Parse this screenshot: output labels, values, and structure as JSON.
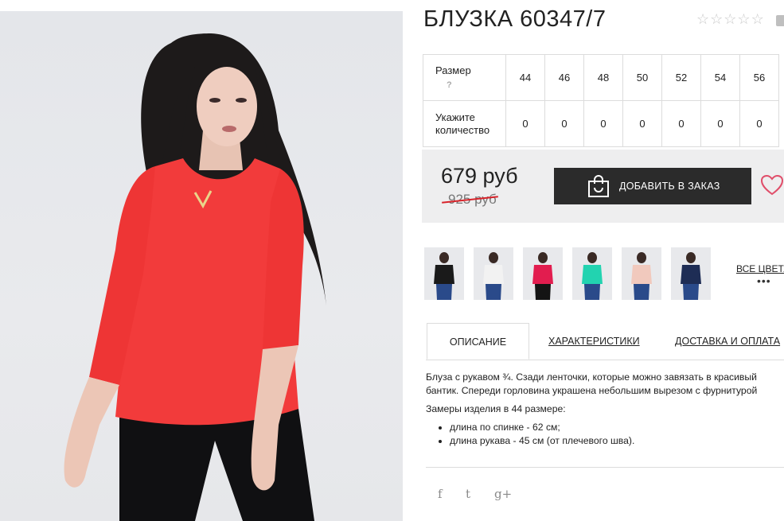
{
  "product": {
    "title": "БЛУЗКА 60347/7",
    "rating_icon": "star-outline-icon",
    "rating_max": 5,
    "rating_value": 0
  },
  "sizes": {
    "label": "Размер",
    "help": "?",
    "qty_label_line1": "Укажите",
    "qty_label_line2": "количество",
    "values": [
      "44",
      "46",
      "48",
      "50",
      "52",
      "54",
      "56"
    ],
    "quantities": [
      "0",
      "0",
      "0",
      "0",
      "0",
      "0",
      "0"
    ]
  },
  "price": {
    "current": "679 руб",
    "old": "925 руб",
    "add_button": "ДОБАВИТЬ В ЗАКАЗ"
  },
  "colors": {
    "all_colors_label": "ВСЕ ЦВЕТА",
    "more": "•••",
    "swatches": [
      "#1a1a1a",
      "#f2f2f2",
      "#e21d4f",
      "#22d3b0",
      "#f1c9bd",
      "#1e2d55"
    ]
  },
  "tabs": [
    {
      "label": "ОПИСАНИЕ",
      "active": true
    },
    {
      "label": "ХАРАКТЕРИСТИКИ",
      "active": false
    },
    {
      "label": "ДОСТАВКА И ОПЛАТА",
      "active": false
    }
  ],
  "description": {
    "line1": "Блуза с рукавом ¾. Сзади ленточки, которые можно завязать в красивый",
    "line2": "бантик. Спереди горловина украшена небольшим вырезом с фурнитурой",
    "measurements_title": "Замеры изделия в 44 размере:",
    "items": [
      "длина по спинке - 62 см;",
      "длина рукава - 45 см (от плечевого шва)."
    ]
  },
  "social": {
    "facebook": "f",
    "twitter": "t",
    "googleplus": "g+"
  },
  "theme": {
    "accent_red": "#d8232a",
    "dark_button": "#2b2b2b",
    "heart": "#e04e6a"
  }
}
